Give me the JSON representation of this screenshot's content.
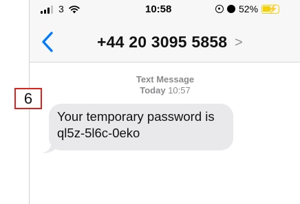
{
  "status_bar": {
    "carrier": "3",
    "time": "10:58",
    "battery": "52%",
    "battery_level": 0.52,
    "battery_color": "#f4d000"
  },
  "nav": {
    "back_icon": "chevron-left-icon",
    "contact": "+44 20 3095 5858",
    "detail_chevron": ">"
  },
  "thread": {
    "message_type": "Text Message",
    "day": "Today",
    "time": "10:57"
  },
  "messages": [
    {
      "direction": "incoming",
      "text": "Your temporary password is ql5z-5l6c-0eko"
    }
  ],
  "annotation": {
    "label": "6",
    "color": "#e0201b"
  },
  "colors": {
    "accent": "#007aff",
    "bubble_incoming": "#e9e9eb",
    "meta_text": "#8a8a8e"
  }
}
